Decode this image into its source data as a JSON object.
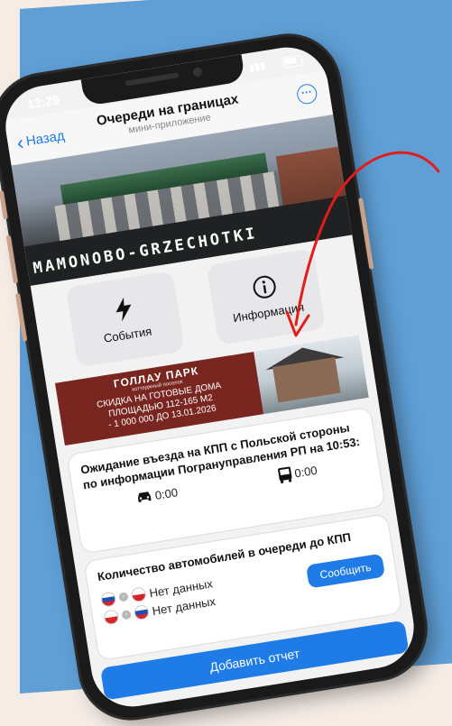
{
  "status_bar": {
    "time": "13:29"
  },
  "nav": {
    "back_label": "Назад",
    "title": "Очереди на границах",
    "subtitle": "мини-приложение"
  },
  "banner": {
    "canopy_text": "",
    "place_name": "MAMONOBO-GRZECHOTKI"
  },
  "tiles": [
    {
      "label": "События",
      "icon": "lightning-icon"
    },
    {
      "label": "Информация",
      "icon": "info-icon"
    }
  ],
  "ad": {
    "brand": "ГОЛЛАУ ПАРК",
    "tagline": "коттеджный поселок",
    "lines": [
      "СКИДКА НА ГОТОВЫЕ ДОМА",
      "ПЛОЩАДЬЮ 112-165 М2",
      "- 1 000 000 ДО 13.01.2026"
    ]
  },
  "wait_card": {
    "text": "Ожидание въезда на КПП с Польской стороны по информации Погрануправления РП на 10:53:",
    "car_wait": "0:00",
    "bus_wait": "0:00"
  },
  "queue_card": {
    "text": "Количество автомобилей в очереди до КПП",
    "row1_value": "Нет данных",
    "row2_value": "Нет данных",
    "report_label": "Сообщить"
  },
  "add_report_label": "Добавить отчет",
  "colors": {
    "accent": "#1f7be6",
    "background_blue": "#5f9fd6",
    "ad_red": "#7a2620",
    "arrow": "#e21b1b"
  }
}
